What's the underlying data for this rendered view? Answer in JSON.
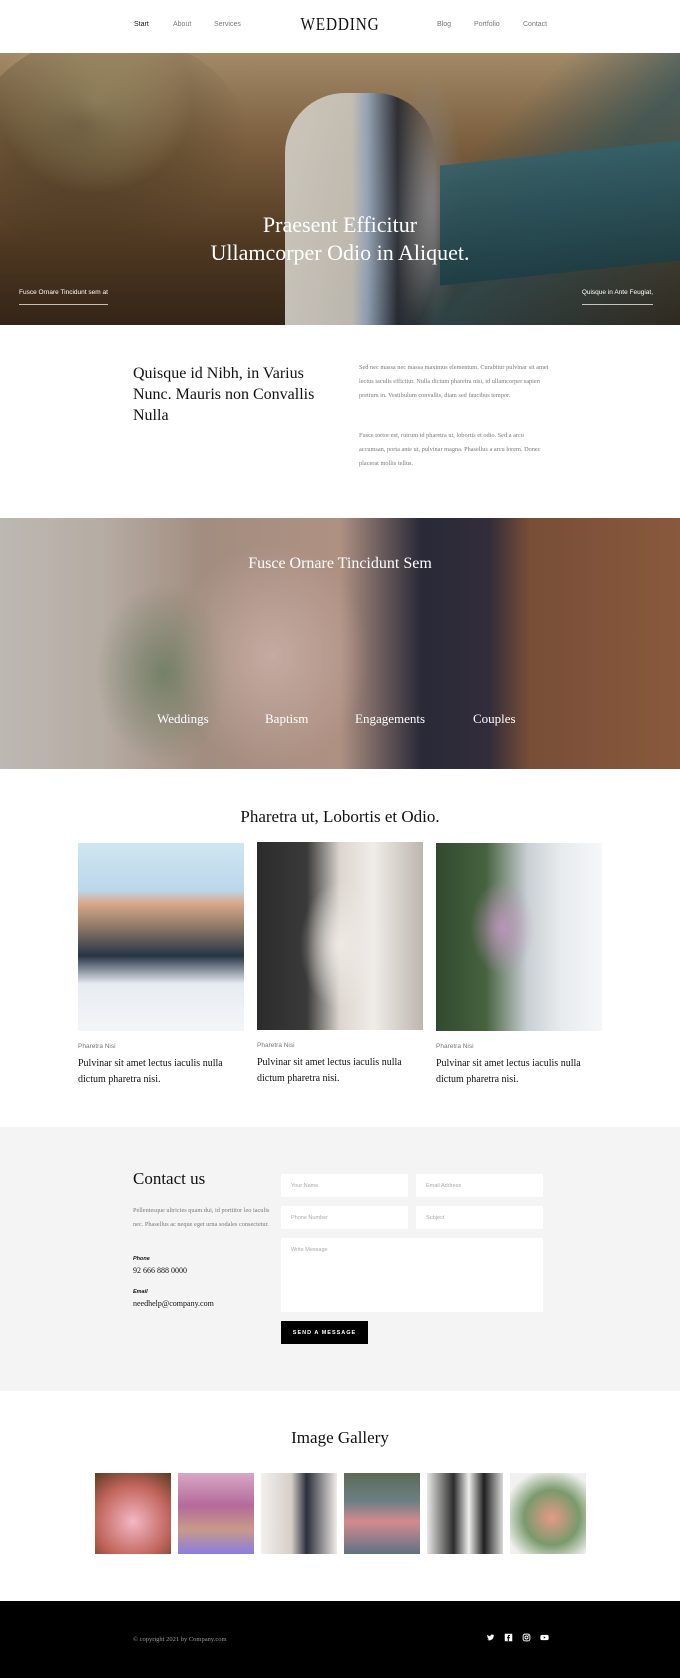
{
  "nav": {
    "left": [
      "Start",
      "About",
      "Services"
    ],
    "brand": "WEDDING",
    "right": [
      "Blog",
      "Portfolio",
      "Contact"
    ]
  },
  "hero": {
    "title_line1": "Praesent Efficitur",
    "title_line2": "Ullamcorper Odio in Aliquet.",
    "left_link": "Fusce Ornare Tincidunt sem at",
    "right_link": "Quisque in Ante Feugiat,"
  },
  "intro": {
    "heading": "Quisque id Nibh, in Varius Nunc. Mauris non Convallis Nulla",
    "p1": "Sed nec massa nec massa maximus elementum. Curabitur pulvinar sit amet lectus iaculis efficitur. Nulla dictum pharetra nisi, id ullamcorper sapien pretium in. Vestibulum convallis, diam sed faucibus tempor.",
    "p2": "Fusce tortor est, rutrum id pharetra ut, lobortis et odio. Sed a arcu accumsan, porta ante ut, pulvinar magna. Phasellus a arcu lorem. Donec placerat mollis tellus."
  },
  "services": {
    "heading": "Fusce Ornare Tincidunt Sem",
    "items": [
      "Weddings",
      "Baptism",
      "Engagements",
      "Couples"
    ]
  },
  "portfolio": {
    "heading": "Pharetra ut, Lobortis et Odio.",
    "cards": [
      {
        "category": "Pharetra Nisi",
        "title": "Pulvinar sit amet lectus iaculis nulla dictum pharetra nisi."
      },
      {
        "category": "Pharetra Nisi",
        "title": "Pulvinar sit amet lectus iaculis nulla dictum pharetra nisi."
      },
      {
        "category": "Pharetra Nisi",
        "title": "Pulvinar sit amet lectus iaculis nulla dictum pharetra nisi."
      }
    ]
  },
  "contact": {
    "heading": "Contact us",
    "description": "Pellentesque ultricies quam dui, id porttitor leo iaculis nec. Phasellus ac neque eget urna sodales consectetur.",
    "phone_label": "Phone",
    "phone": "92 666 888 0000",
    "email_label": "Email",
    "email": "needhelp@company.com",
    "placeholders": {
      "name": "Your Name",
      "email": "Email Address",
      "phone": "Phone Number",
      "subject": "Subject",
      "message": "Write Message"
    },
    "send_label": "SEND A MESSAGE"
  },
  "gallery": {
    "heading": "Image Gallery"
  },
  "footer": {
    "copyright": "© copyright 2021 by Company.com",
    "social_icons": [
      "twitter-icon",
      "facebook-icon",
      "instagram-icon",
      "youtube-icon"
    ]
  }
}
